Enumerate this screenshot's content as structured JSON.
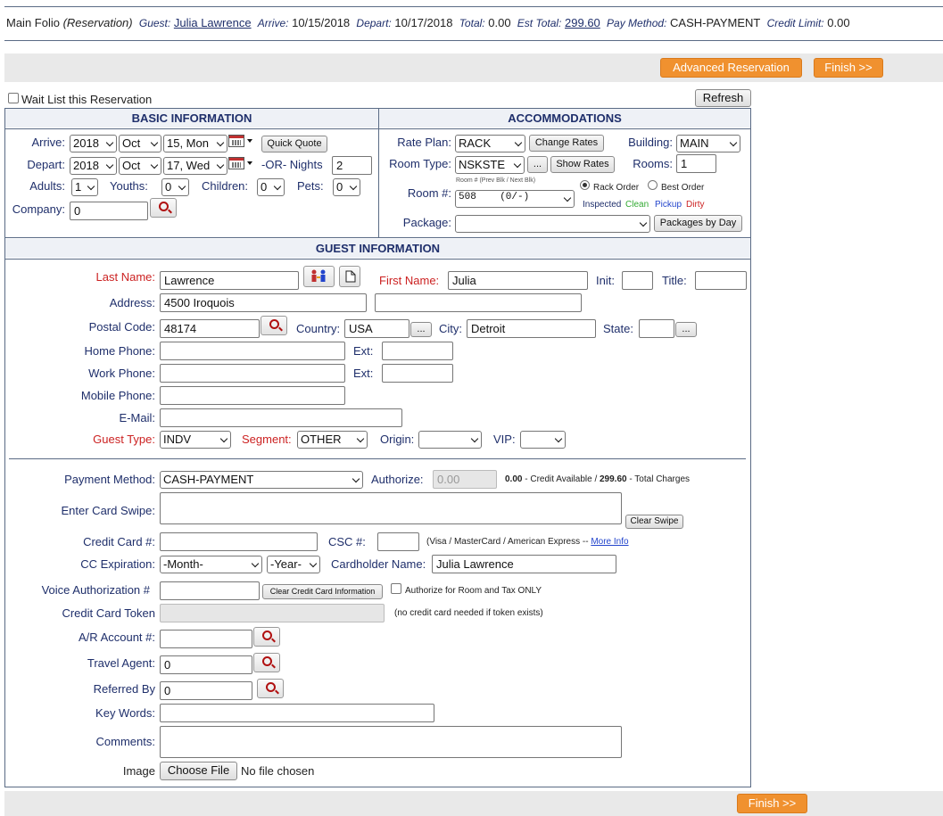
{
  "folio": {
    "title": "Main Folio",
    "subtitle": "(Reservation)",
    "guest_label": "Guest:",
    "guest_name": "Julia Lawrence",
    "arrive_label": "Arrive:",
    "arrive": "10/15/2018",
    "depart_label": "Depart:",
    "depart": "10/17/2018",
    "total_label": "Total:",
    "total": "0.00",
    "est_total_label": "Est Total:",
    "est_total": "299.60",
    "pay_method_label": "Pay Method:",
    "pay_method": "CASH-PAYMENT",
    "credit_limit_label": "Credit Limit:",
    "credit_limit": "0.00"
  },
  "toolbar": {
    "advanced_reservation": "Advanced Reservation",
    "finish": "Finish >>",
    "wait_list": "Wait List this Reservation",
    "refresh": "Refresh"
  },
  "basic": {
    "heading": "BASIC INFORMATION",
    "arrive_label": "Arrive:",
    "arrive_year": "2018",
    "arrive_month": "Oct",
    "arrive_day": "15, Mon",
    "quick_quote": "Quick Quote",
    "depart_label": "Depart:",
    "depart_year": "2018",
    "depart_month": "Oct",
    "depart_day": "17, Wed",
    "nights_label": "-OR- Nights",
    "nights": "2",
    "adults_label": "Adults:",
    "adults": "1",
    "youths_label": "Youths:",
    "youths": "0",
    "children_label": "Children:",
    "children": "0",
    "pets_label": "Pets:",
    "pets": "0",
    "company_label": "Company:",
    "company": "0"
  },
  "accommodations": {
    "heading": "ACCOMMODATIONS",
    "rate_plan_label": "Rate Plan:",
    "rate_plan": "RACK",
    "change_rates": "Change Rates",
    "building_label": "Building:",
    "building": "MAIN",
    "room_type_label": "Room Type:",
    "room_type": "NSKSTE",
    "ellipsis": "...",
    "show_rates": "Show Rates",
    "rooms_label": "Rooms:",
    "rooms": "1",
    "room_hint": "Room # (Prev Blk / Next Blk)",
    "room_label": "Room #:",
    "room": "508    (0/-)",
    "rack_order": "Rack Order",
    "best_order": "Best Order",
    "inspected": "Inspected",
    "clean": "Clean",
    "pickup": "Pickup",
    "dirty": "Dirty",
    "package_label": "Package:",
    "package": "",
    "packages_by_day": "Packages by Day"
  },
  "guest": {
    "heading": "GUEST INFORMATION",
    "last_name_label": "Last Name:",
    "last_name": "Lawrence",
    "first_name_label": "First Name:",
    "first_name": "Julia",
    "init_label": "Init:",
    "init": "",
    "title_label": "Title:",
    "title": "",
    "address_label": "Address:",
    "address1": "4500 Iroquois",
    "address2": "",
    "postal_label": "Postal Code:",
    "postal": "48174",
    "country_label": "Country:",
    "country": "USA",
    "city_label": "City:",
    "city": "Detroit",
    "state_label": "State:",
    "state": "",
    "home_phone_label": "Home Phone:",
    "work_phone_label": "Work Phone:",
    "mobile_phone_label": "Mobile Phone:",
    "ext_label": "Ext:",
    "email_label": "E-Mail:",
    "guest_type_label": "Guest Type:",
    "guest_type": "INDV",
    "segment_label": "Segment:",
    "segment": "OTHER",
    "origin_label": "Origin:",
    "origin": "",
    "vip_label": "VIP:",
    "vip": ""
  },
  "payment": {
    "method_label": "Payment Method:",
    "method": "CASH-PAYMENT",
    "authorize_label": "Authorize:",
    "authorize": "0.00",
    "credit_available_amt": "0.00",
    "credit_available": "- Credit Available  /",
    "total_charges_amt": "299.60",
    "total_charges": "- Total Charges",
    "card_swipe_label": "Enter Card Swipe:",
    "clear_swipe": "Clear Swipe",
    "cc_label": "Credit Card #:",
    "csc_label": "CSC #:",
    "cards_note": "(Visa / MasterCard / American Express --",
    "more_info": "More Info",
    "expiration_label": "CC Expiration:",
    "exp_month": "-Month-",
    "exp_year": "-Year-",
    "cardholder_label": "Cardholder Name:",
    "cardholder": "Julia Lawrence",
    "voice_auth_label": "Voice Authorization #",
    "clear_cc": "Clear Credit Card Information",
    "auth_room_tax": "Authorize for Room and Tax ONLY",
    "token_label": "Credit Card Token",
    "token_note": "(no credit card needed if token exists)",
    "ar_label": "A/R Account #:",
    "travel_agent_label": "Travel Agent:",
    "travel_agent": "0",
    "referred_label": "Referred By",
    "referred": "0",
    "keywords_label": "Key Words:",
    "comments_label": "Comments:",
    "image_label": "Image",
    "choose_file": "Choose File",
    "no_file": "No file chosen"
  },
  "colors": {
    "orange": "#f0912f",
    "navy": "#1f2f6b",
    "red": "#cc2222",
    "green": "#33aa33",
    "blue": "#2244cc"
  }
}
